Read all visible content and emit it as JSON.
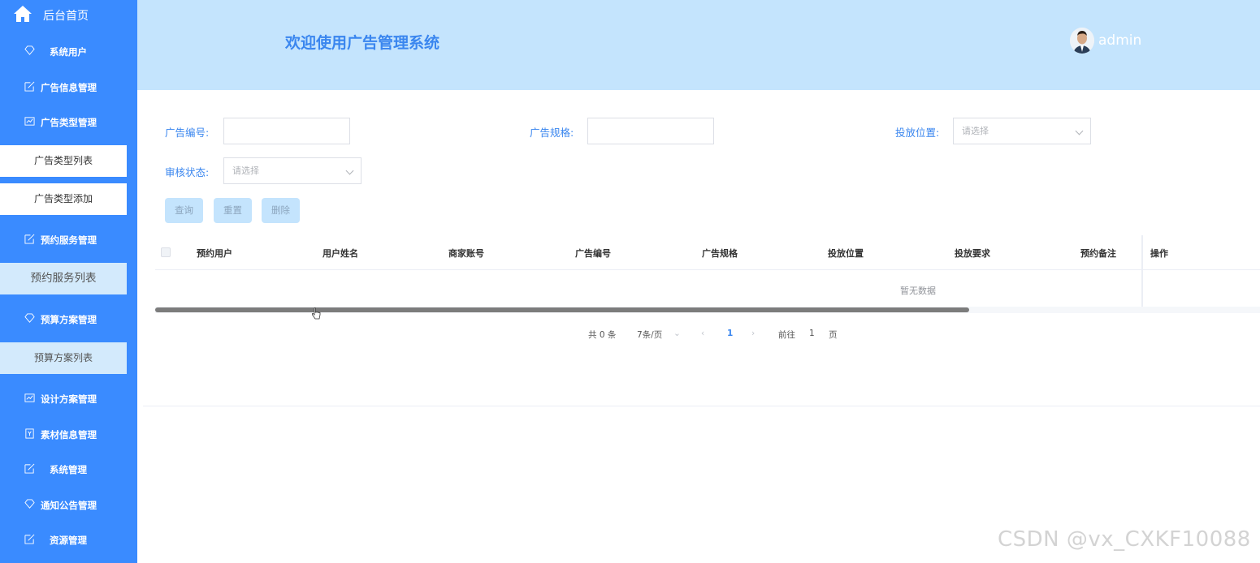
{
  "sidebar": {
    "home": "后台首页",
    "items": [
      {
        "label": "系统用户"
      },
      {
        "label": "广告信息管理"
      },
      {
        "label": "广告类型管理"
      },
      {
        "label": "预约服务管理"
      },
      {
        "label": "预算方案管理"
      },
      {
        "label": "设计方案管理"
      },
      {
        "label": "素材信息管理"
      },
      {
        "label": "系统管理"
      },
      {
        "label": "通知公告管理"
      },
      {
        "label": "资源管理"
      }
    ],
    "subs": {
      "type_list": "广告类型列表",
      "type_add": "广告类型添加",
      "booking_list": "预约服务列表",
      "budget_list": "预算方案列表"
    }
  },
  "header": {
    "title": "欢迎使用广告管理系统",
    "user": "admin"
  },
  "search": {
    "ad_no_label": "广告编号:",
    "ad_spec_label": "广告规格:",
    "position_label": "投放位置:",
    "position_placeholder": "请选择",
    "review_label": "审核状态:",
    "review_placeholder": "请选择"
  },
  "buttons": {
    "query": "查询",
    "reset": "重置",
    "delete": "删除"
  },
  "table": {
    "columns": [
      "预约用户",
      "用户姓名",
      "商家账号",
      "广告编号",
      "广告规格",
      "投放位置",
      "投放要求",
      "预约备注",
      "操作"
    ],
    "empty": "暂无数据"
  },
  "pagination": {
    "total": "共 0 条",
    "page_size": "7条/页",
    "current": "1",
    "goto": "前往",
    "goto_value": "1",
    "page_suffix": "页"
  },
  "watermark": "CSDN @vx_CXKF10088",
  "colors": {
    "sidebar": "#3a8bff",
    "header": "#c4e4fd",
    "accent": "#3a86ef"
  }
}
